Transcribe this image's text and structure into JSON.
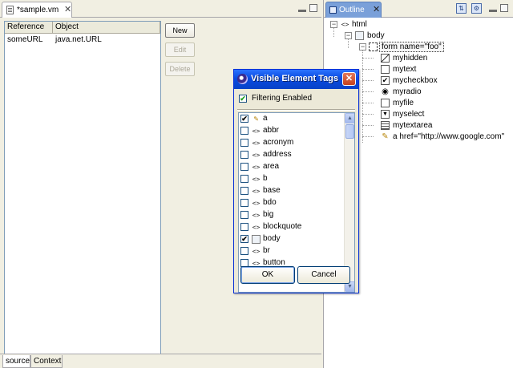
{
  "editor": {
    "tab_title": "*sample.vm",
    "columns": [
      "Reference",
      "Object"
    ],
    "rows": [
      {
        "reference": "someURL",
        "object": "java.net.URL"
      }
    ],
    "buttons": {
      "new": "New",
      "edit": "Edit",
      "delete": "Delete"
    },
    "bottom_tabs": [
      "source",
      "Context"
    ]
  },
  "outline": {
    "tab_title": "Outline",
    "tree": [
      {
        "label": "html",
        "icon": "tag-icon"
      },
      {
        "label": "body",
        "icon": "page-icon"
      },
      {
        "label": "form name=\"foo\"",
        "icon": "form-icon"
      },
      {
        "label": "myhidden",
        "icon": "hidden-field-icon"
      },
      {
        "label": "mytext",
        "icon": "text-field-icon"
      },
      {
        "label": "mycheckbox",
        "icon": "checkbox-icon"
      },
      {
        "label": "myradio",
        "icon": "radio-icon"
      },
      {
        "label": "myfile",
        "icon": "file-icon"
      },
      {
        "label": "myselect",
        "icon": "select-icon"
      },
      {
        "label": "mytextarea",
        "icon": "textarea-icon"
      },
      {
        "label": "a href=\"http://www.google.com\"",
        "icon": "anchor-icon"
      }
    ]
  },
  "dialog": {
    "title": "Visible Element Tags",
    "filter_label": "Filtering Enabled",
    "filter_checked": true,
    "items": [
      {
        "label": "a",
        "checked": true,
        "icon": "anchor-icon"
      },
      {
        "label": "abbr",
        "checked": false,
        "icon": "tag-icon"
      },
      {
        "label": "acronym",
        "checked": false,
        "icon": "tag-icon"
      },
      {
        "label": "address",
        "checked": false,
        "icon": "tag-icon"
      },
      {
        "label": "area",
        "checked": false,
        "icon": "tag-icon"
      },
      {
        "label": "b",
        "checked": false,
        "icon": "tag-icon"
      },
      {
        "label": "base",
        "checked": false,
        "icon": "tag-icon"
      },
      {
        "label": "bdo",
        "checked": false,
        "icon": "tag-icon"
      },
      {
        "label": "big",
        "checked": false,
        "icon": "tag-icon"
      },
      {
        "label": "blockquote",
        "checked": false,
        "icon": "tag-icon"
      },
      {
        "label": "body",
        "checked": true,
        "icon": "page-icon"
      },
      {
        "label": "br",
        "checked": false,
        "icon": "tag-icon"
      },
      {
        "label": "button",
        "checked": false,
        "icon": "tag-icon"
      }
    ],
    "ok_label": "OK",
    "cancel_label": "Cancel"
  }
}
